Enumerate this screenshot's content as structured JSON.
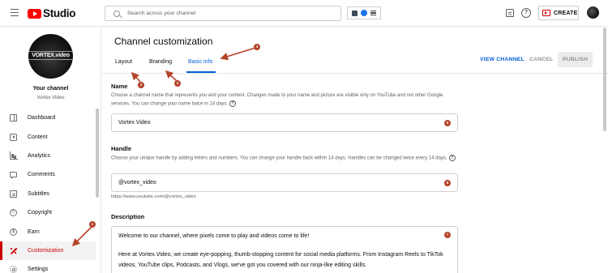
{
  "topbar": {
    "logo_text": "Studio",
    "search_placeholder": "Search across your channel",
    "create_label": "CREATE"
  },
  "sidebar": {
    "channel_avatar_text": "VORTEX.video",
    "your_channel": "Your channel",
    "channel_name": "Vortex Video",
    "items": [
      {
        "label": "Dashboard",
        "icon": "dashboard-icon"
      },
      {
        "label": "Content",
        "icon": "content-icon"
      },
      {
        "label": "Analytics",
        "icon": "analytics-icon"
      },
      {
        "label": "Comments",
        "icon": "comments-icon"
      },
      {
        "label": "Subtitles",
        "icon": "subtitles-icon"
      },
      {
        "label": "Copyright",
        "icon": "copyright-icon"
      },
      {
        "label": "Earn",
        "icon": "earn-icon"
      },
      {
        "label": "Customization",
        "icon": "customization-icon",
        "active": true
      },
      {
        "label": "Settings",
        "icon": "settings-icon"
      }
    ]
  },
  "main": {
    "title": "Channel customization",
    "tabs": [
      {
        "label": "Layout"
      },
      {
        "label": "Branding"
      },
      {
        "label": "Basic info",
        "active": true
      }
    ],
    "view_channel": "VIEW CHANNEL",
    "cancel": "CANCEL",
    "publish": "PUBLISH",
    "name": {
      "label": "Name",
      "desc": "Choose a channel name that represents you and your content. Changes made to your name and picture are visible only on YouTube and not other Google services. You can change your name twice in 14 days.",
      "value": "Vortex Video"
    },
    "handle": {
      "label": "Handle",
      "desc": "Choose your unique handle by adding letters and numbers. You can change your handle back within 14 days. Handles can be changed twice every 14 days.",
      "value": "@vortex_video",
      "url": "https://www.youtube.com/@vortex_video"
    },
    "description": {
      "label": "Description",
      "para1": "Welcome to our channel, where pixels come to play and videos come to life!",
      "para2": "Here at Vortex.Video, we create eye-popping, thumb-stopping content for social media platforms. From Instagram Reels to TikTok videos, YouTube clips, Podcasts, and Vlogs, we've got you covered with our ninja-like editing skills."
    }
  },
  "annotations": {
    "badges": [
      "1",
      "2",
      "3",
      "4",
      "5",
      "6",
      "7"
    ],
    "color": "#b5432a"
  }
}
